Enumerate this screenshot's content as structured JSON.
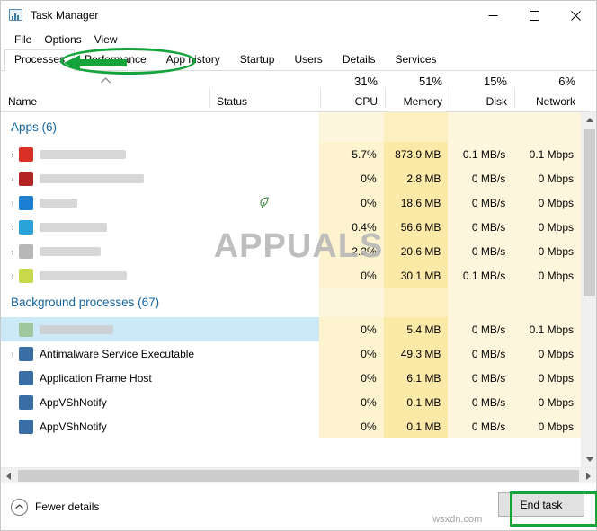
{
  "window": {
    "title": "Task Manager",
    "icon": "task-manager-icon",
    "minimize": "–",
    "maximize": "□",
    "close": "✕"
  },
  "menu": [
    "File",
    "Options",
    "View"
  ],
  "tabs": [
    {
      "label": "Processes",
      "active": true
    },
    {
      "label": "Performance",
      "active": false
    },
    {
      "label": "App history",
      "active": false
    },
    {
      "label": "Startup",
      "active": false
    },
    {
      "label": "Users",
      "active": false
    },
    {
      "label": "Details",
      "active": false
    },
    {
      "label": "Services",
      "active": false
    }
  ],
  "columns": [
    {
      "name": "Name",
      "value": ""
    },
    {
      "name": "Status",
      "value": ""
    },
    {
      "name": "CPU",
      "value": "31%"
    },
    {
      "name": "Memory",
      "value": "51%"
    },
    {
      "name": "Disk",
      "value": "15%"
    },
    {
      "name": "Network",
      "value": "6%"
    }
  ],
  "groups": [
    {
      "label": "Apps (6)"
    },
    {
      "label": "Background processes (67)"
    }
  ],
  "rows": [
    {
      "group": "apps",
      "name": "",
      "blurred": true,
      "blur_width": 96,
      "icon_color": "#d93025",
      "expandable": true,
      "status": "",
      "cpu": "5.7%",
      "memory": "873.9 MB",
      "disk": "0.1 MB/s",
      "network": "0.1 Mbps",
      "selected": false
    },
    {
      "group": "apps",
      "name": "",
      "blurred": true,
      "blur_width": 116,
      "icon_color": "#b32424",
      "expandable": true,
      "status": "",
      "cpu": "0%",
      "memory": "2.8 MB",
      "disk": "0 MB/s",
      "network": "0 Mbps",
      "selected": false
    },
    {
      "group": "apps",
      "name": "",
      "blurred": true,
      "blur_width": 42,
      "icon_color": "#1d7fd4",
      "expandable": true,
      "status": "leaf-icon",
      "cpu": "0%",
      "memory": "18.6 MB",
      "disk": "0 MB/s",
      "network": "0 Mbps",
      "selected": false
    },
    {
      "group": "apps",
      "name": "",
      "blurred": true,
      "blur_width": 75,
      "icon_color": "#29a3d9",
      "expandable": true,
      "status": "",
      "cpu": "0.4%",
      "memory": "56.6 MB",
      "disk": "0 MB/s",
      "network": "0 Mbps",
      "selected": false
    },
    {
      "group": "apps",
      "name": "",
      "blurred": true,
      "blur_width": 68,
      "icon_color": "#b8b8b8",
      "expandable": true,
      "status": "",
      "cpu": "2.3%",
      "memory": "20.6 MB",
      "disk": "0 MB/s",
      "network": "0 Mbps",
      "selected": false
    },
    {
      "group": "apps",
      "name": "",
      "blurred": true,
      "blur_width": 97,
      "icon_color": "#c8d94a",
      "expandable": true,
      "status": "",
      "cpu": "0%",
      "memory": "30.1 MB",
      "disk": "0.1 MB/s",
      "network": "0 Mbps",
      "selected": false
    },
    {
      "group": "bg",
      "name": "",
      "blurred": true,
      "blur_width": 82,
      "icon_color": "#9ec79e",
      "expandable": false,
      "status": "",
      "cpu": "0%",
      "memory": "5.4 MB",
      "disk": "0 MB/s",
      "network": "0.1 Mbps",
      "selected": true
    },
    {
      "group": "bg",
      "name": "Antimalware Service Executable",
      "blurred": false,
      "icon_color": "#3a6ea5",
      "expandable": true,
      "status": "",
      "cpu": "0%",
      "memory": "49.3 MB",
      "disk": "0 MB/s",
      "network": "0 Mbps",
      "selected": false
    },
    {
      "group": "bg",
      "name": "Application Frame Host",
      "blurred": false,
      "icon_color": "#3a6ea5",
      "expandable": false,
      "status": "",
      "cpu": "0%",
      "memory": "6.1 MB",
      "disk": "0 MB/s",
      "network": "0 Mbps",
      "selected": false
    },
    {
      "group": "bg",
      "name": "AppVShNotify",
      "blurred": false,
      "icon_color": "#3a6ea5",
      "expandable": false,
      "status": "",
      "cpu": "0%",
      "memory": "0.1 MB",
      "disk": "0 MB/s",
      "network": "0 Mbps",
      "selected": false
    },
    {
      "group": "bg",
      "name": "AppVShNotify",
      "blurred": false,
      "icon_color": "#3a6ea5",
      "expandable": false,
      "status": "",
      "cpu": "0%",
      "memory": "0.1 MB",
      "disk": "0 MB/s",
      "network": "0 Mbps",
      "selected": false
    }
  ],
  "footer": {
    "fewer_details": "Fewer details",
    "end_task": "End task"
  },
  "watermark": {
    "text": "APPUALS",
    "sub": "wsxdn.com"
  },
  "annotations": {
    "accent_color": "#15a33c",
    "tab_highlight": "performance-app-history-tabs",
    "button_highlight": "end-task-button"
  }
}
